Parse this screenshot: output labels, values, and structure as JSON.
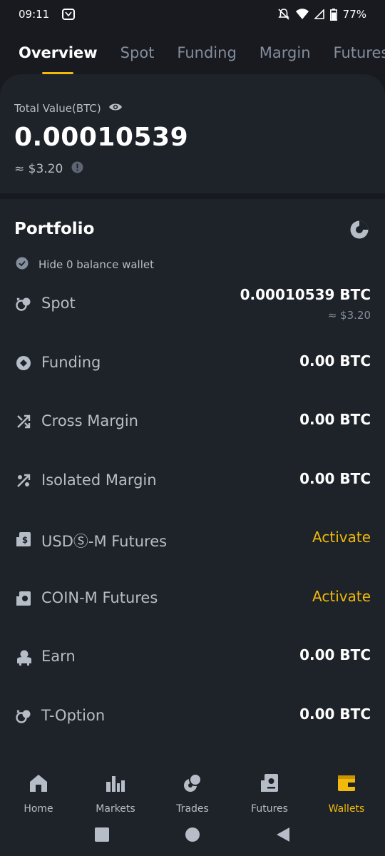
{
  "status_bar": {
    "time": "09:11",
    "battery": "77%"
  },
  "tabs": [
    {
      "label": "Overview",
      "active": true
    },
    {
      "label": "Spot",
      "active": false
    },
    {
      "label": "Funding",
      "active": false
    },
    {
      "label": "Margin",
      "active": false
    },
    {
      "label": "Futures",
      "active": false
    }
  ],
  "total": {
    "label": "Total Value(BTC)",
    "value": "0.00010539",
    "usd": "≈ $3.20"
  },
  "portfolio": {
    "title": "Portfolio",
    "hide_zero_label": "Hide 0 balance wallet",
    "rows": [
      {
        "icon": "spot-icon",
        "label": "Spot",
        "value": "0.00010539 BTC",
        "sub": "≈ $3.20"
      },
      {
        "icon": "funding-icon",
        "label": "Funding",
        "value": "0.00 BTC"
      },
      {
        "icon": "cross-margin-icon",
        "label": "Cross Margin",
        "value": "0.00 BTC"
      },
      {
        "icon": "isolated-margin-icon",
        "label": "Isolated Margin",
        "value": "0.00 BTC"
      },
      {
        "icon": "usds-futures-icon",
        "label": "USDⓈ-M Futures",
        "value": "Activate"
      },
      {
        "icon": "coin-futures-icon",
        "label": "COIN-M Futures",
        "value": "Activate"
      },
      {
        "icon": "earn-icon",
        "label": "Earn",
        "value": "0.00 BTC"
      },
      {
        "icon": "t-option-icon",
        "label": "T-Option",
        "value": "0.00 BTC"
      }
    ]
  },
  "bottom_nav": [
    {
      "label": "Home",
      "icon": "home-icon"
    },
    {
      "label": "Markets",
      "icon": "markets-icon"
    },
    {
      "label": "Trades",
      "icon": "trades-icon"
    },
    {
      "label": "Futures",
      "icon": "futures-icon"
    },
    {
      "label": "Wallets",
      "icon": "wallet-icon",
      "active": true
    }
  ],
  "colors": {
    "accent": "#f0b90b",
    "background": "#181a20",
    "card": "#1e2329"
  }
}
